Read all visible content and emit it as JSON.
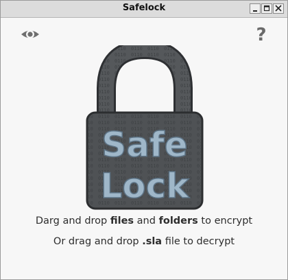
{
  "window": {
    "title": "Safelock"
  },
  "toolbar": {
    "eye_icon": "eye-icon",
    "help_label": "?"
  },
  "logo": {
    "text_top": "Safe",
    "text_bottom": "Lock",
    "binary_row": "0110100101101001011010011"
  },
  "instructions": {
    "line1_pre": "Darg and drop ",
    "line1_files": "files",
    "line1_and": " and ",
    "line1_folders": "folders",
    "line1_post": " to encrypt",
    "line2_pre": "Or drag and drop ",
    "line2_ext": ".sla",
    "line2_post": " file to decrypt"
  },
  "colors": {
    "lock_body": "#5a5d60",
    "lock_text": "#9fb7c9",
    "text": "#2d2d2d"
  }
}
